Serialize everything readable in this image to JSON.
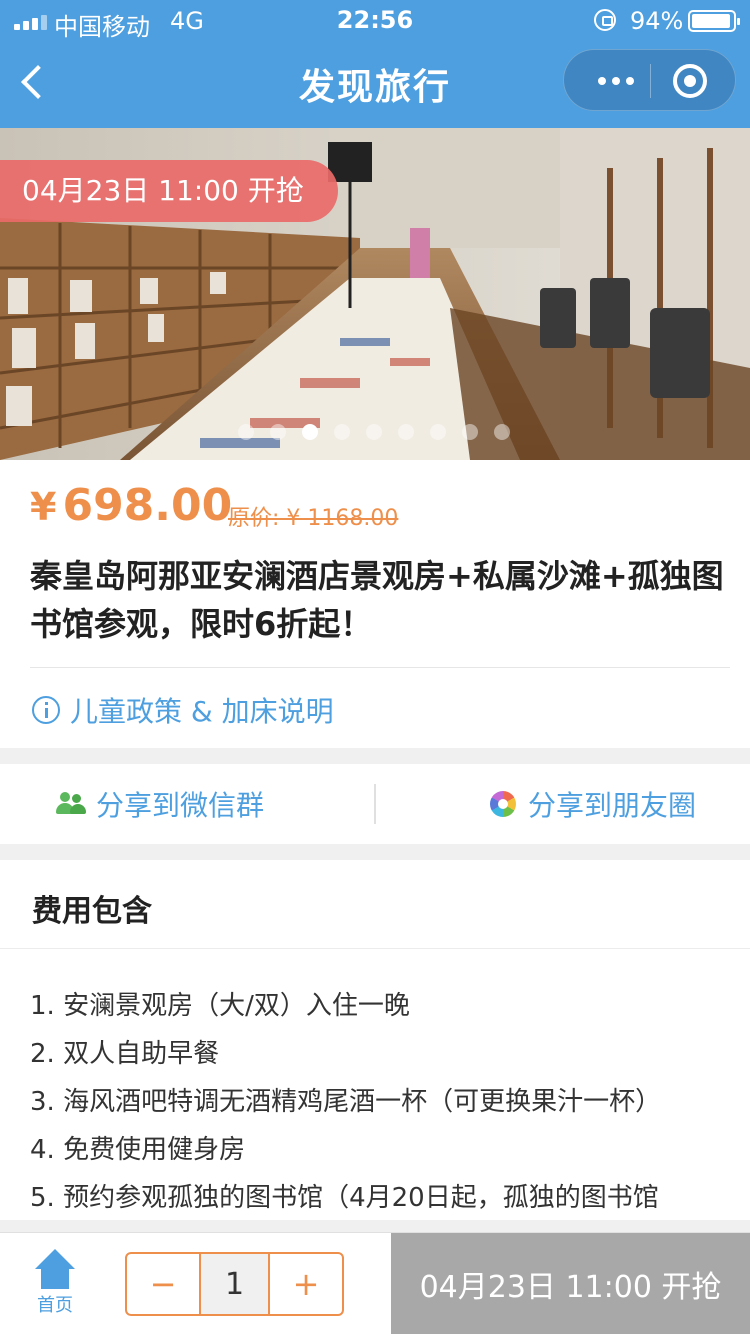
{
  "status_bar": {
    "carrier": "中国移动",
    "network": "4G",
    "time": "22:56",
    "battery_percent": "94%",
    "battery_level": 0.94
  },
  "nav": {
    "title": "发现旅行"
  },
  "banner": {
    "sale_tag": "04月23日 11:00 开抢",
    "slide_count": 9,
    "active_slide": 3
  },
  "product": {
    "price_symbol": "¥",
    "price": "698.00",
    "original_price": "原价: ¥ 1168.00",
    "title": "秦皇岛阿那亚安澜酒店景观房+私属沙滩+孤独图书馆参观，限时6折起！",
    "policy_link": "儿童政策 & 加床说明"
  },
  "share": {
    "wechat_group": "分享到微信群",
    "moments": "分享到朋友圈"
  },
  "fees": {
    "heading": "费用包含",
    "items": [
      "1. 安澜景观房（大/双）入住一晚",
      "2. 双人自助早餐",
      "3. 海风酒吧特调无酒精鸡尾酒一杯（可更换果汁一杯）",
      "4. 免费使用健身房",
      "5. 预约参观孤独的图书馆（4月20日起，孤独的图书馆"
    ]
  },
  "bottom_bar": {
    "home_label": "首页",
    "minus": "−",
    "quantity": "1",
    "plus": "+",
    "buy_label": "04月23日 11:00 开抢"
  },
  "colors": {
    "primary_blue": "#4d9fdf",
    "price_orange": "#ee8f4b",
    "tag_red": "#e96a68",
    "disabled_gray": "#a8a8a8"
  }
}
